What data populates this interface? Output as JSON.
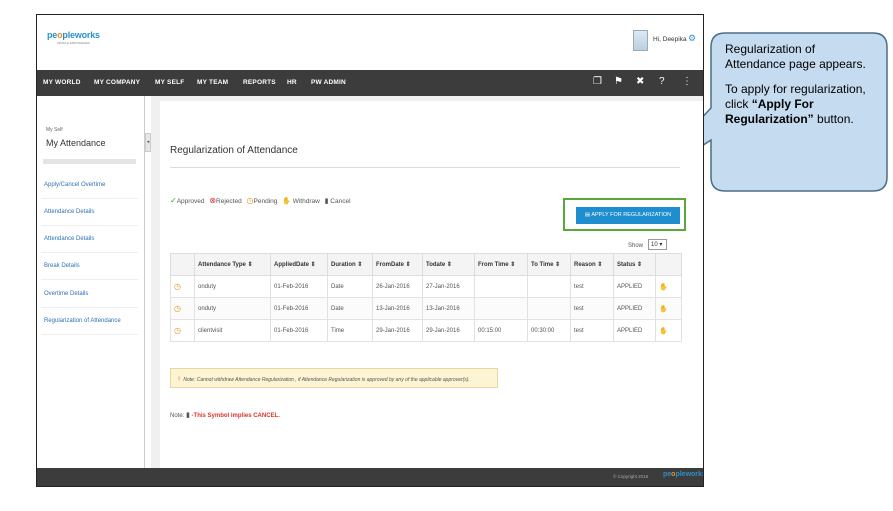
{
  "header": {
    "logo_pre": "pe",
    "logo_o": "o",
    "logo_post": "pleworks",
    "logo_tagline": "PEOPLE EMPOWERED",
    "greeting": "Hi, Deepika"
  },
  "nav": {
    "items": [
      "MY WORLD",
      "MY COMPANY",
      "MY SELF",
      "MY TEAM",
      "REPORTS",
      "HR",
      "PW ADMIN"
    ],
    "icons": [
      "book-icon",
      "flag-icon",
      "tools-icon",
      "help-icon",
      "share-icon"
    ]
  },
  "sidebar": {
    "crumb": "My Self",
    "title": "My Attendance",
    "links": [
      "Apply/Cancel Overtime",
      "Attendance Details",
      "Attendance Details",
      "Break Details",
      "Overtime Details",
      "Regularization of Attendance"
    ]
  },
  "content": {
    "title": "Regularization of Attendance",
    "legend": {
      "approved": "Approved",
      "rejected": "Rejected",
      "pending": "Pending",
      "withdraw": "Withdraw",
      "cancel": "Cancel"
    },
    "apply_button": "APPLY FOR REGULARIZATION",
    "show_label": "Show",
    "show_value": "10 ▾",
    "columns": [
      "",
      "Attendance Type ⇕",
      "AppliedDate ⇕",
      "Duration ⇕",
      "FromDate ⇕",
      "Todate ⇕",
      "From Time ⇕",
      "To Time ⇕",
      "Reason ⇕",
      "Status ⇕",
      ""
    ],
    "rows": [
      [
        "onduty",
        "01-Feb-2016",
        "Date",
        "26-Jan-2016",
        "27-Jan-2016",
        "",
        "",
        "test",
        "APPLIED"
      ],
      [
        "onduty",
        "01-Feb-2016",
        "Date",
        "13-Jan-2016",
        "13-Jan-2016",
        "",
        "",
        "test",
        "APPLIED"
      ],
      [
        "clientvisit",
        "01-Feb-2016",
        "Time",
        "29-Jan-2016",
        "29-Jan-2016",
        "00:15:00",
        "00:30:00",
        "test",
        "APPLIED"
      ]
    ],
    "note": "Note: Cannot withdraw Attendance Regularization , if Attendance Regularization is approved by any of the applicable approver(s).",
    "note2_prefix": "Note:",
    "note2_red": "-This Symbol implies CANCEL."
  },
  "footer": {
    "copyright": "© Copyright 2016",
    "logo_pre": "pe",
    "logo_o": "o",
    "logo_post": "pleworks"
  },
  "callout": {
    "line1": "Regularization of Attendance page appears.",
    "line2_pre": "To apply for regularization, click",
    "line2_bold": "“Apply For Regularization”",
    "line2_post": " button."
  },
  "colors": {
    "nav_bg": "#3c3c3c",
    "button_blue": "#1e8ecf",
    "highlight_green": "#5aa83a",
    "callout_fill": "#c5dbef",
    "callout_stroke": "#4a6d8c"
  }
}
